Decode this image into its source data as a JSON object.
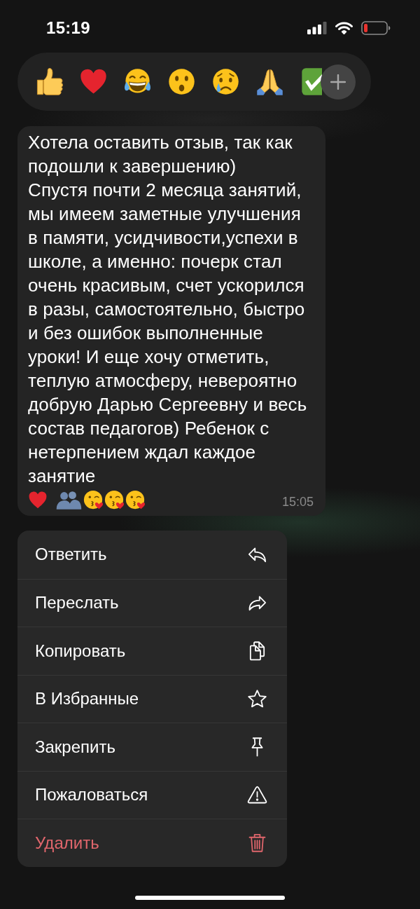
{
  "status_bar": {
    "time": "15:19"
  },
  "message": {
    "text": "Хотела оставить отзыв, так как подошли к завершению)\nСпустя почти 2 месяца занятий, мы имеем заметные улучшения в памяти, усидчивости,успехи в школе, а именно: почерк стал очень красивым, счет ускорился в разы, самостоятельно, быстро и без ошибок выполненные уроки! И еще хочу отметить, теплую атмосферу, невероятно добрую Дарью Сергеевну и весь состав педагогов) Ребенок с нетерпением ждал каждое занятие",
    "time": "15:05"
  },
  "context_menu": {
    "items": [
      {
        "label": "Ответить",
        "kind": "reply",
        "destructive": false
      },
      {
        "label": "Переслать",
        "kind": "forward",
        "destructive": false
      },
      {
        "label": "Копировать",
        "kind": "copy",
        "destructive": false
      },
      {
        "label": "В Избранные",
        "kind": "favorite",
        "destructive": false
      },
      {
        "label": "Закрепить",
        "kind": "pin",
        "destructive": false
      },
      {
        "label": "Пожаловаться",
        "kind": "report",
        "destructive": false
      },
      {
        "label": "Удалить",
        "kind": "delete",
        "destructive": true
      }
    ]
  }
}
